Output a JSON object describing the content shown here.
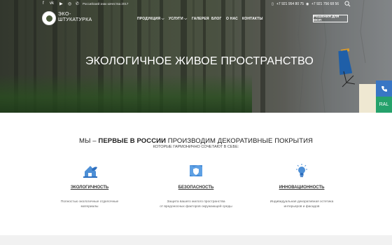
{
  "topbar": {
    "social_icons": [
      "facebook-icon",
      "vk-icon",
      "youtube-icon",
      "instagram-icon",
      "odnoklassniki-icon"
    ],
    "quality_badge": "Российский знак качества 2017",
    "phone1": "+7 921 954 80 75",
    "phone2": "+7 921 756 68 56"
  },
  "logo": {
    "line1": "ЭКО-",
    "line2": "ШТУКАТУРКА"
  },
  "nav": {
    "items": [
      {
        "label": "ПРОДУКЦИЯ ⌵"
      },
      {
        "label": "УСЛУГИ ⌵"
      },
      {
        "label": "ГАЛЕРЕЯ"
      },
      {
        "label": "БЛОГ"
      },
      {
        "label": "О НАС"
      },
      {
        "label": "КОНТАКТЫ"
      }
    ],
    "cta": "РЕШЕНИЯ ДЛЯ МОП"
  },
  "hero": {
    "title": "ЭКОЛОГИЧНОЕ ЖИВОЕ ПРОСТРАНСТВО"
  },
  "side": {
    "ral": "RAL"
  },
  "intro": {
    "heading_pre": "МЫ – ",
    "heading_bold": "ПЕРВЫЕ В РОССИИ",
    "heading_post": " ПРОИЗВОДИМ ДЕКОРАТИВНЫЕ ПОКРЫТИЯ",
    "subheading": "КОТОРЫЕ ГАРМОНИЧНО СОЧЕТАЮТ В СЕБЕ:"
  },
  "features": [
    {
      "icon": "eco-house-icon",
      "title": "ЭКОЛОГИЧНОСТЬ",
      "desc1": "Полностью экологичные отделочные",
      "desc2": "материалы"
    },
    {
      "icon": "shield-map-icon",
      "title": "БЕЗОПАСНОСТЬ",
      "desc1": "Защита вашего жилого пространства",
      "desc2": "от вредоносных факторов окружающей среды"
    },
    {
      "icon": "lightbulb-icon",
      "title": "ИННОВАЦИОННОСТЬ",
      "desc1": "Индивидуальная декоративная эстетика",
      "desc2": "интерьеров и фасадов"
    }
  ],
  "colors": {
    "accent_blue": "#3876c4",
    "accent_green": "#25a16b"
  }
}
